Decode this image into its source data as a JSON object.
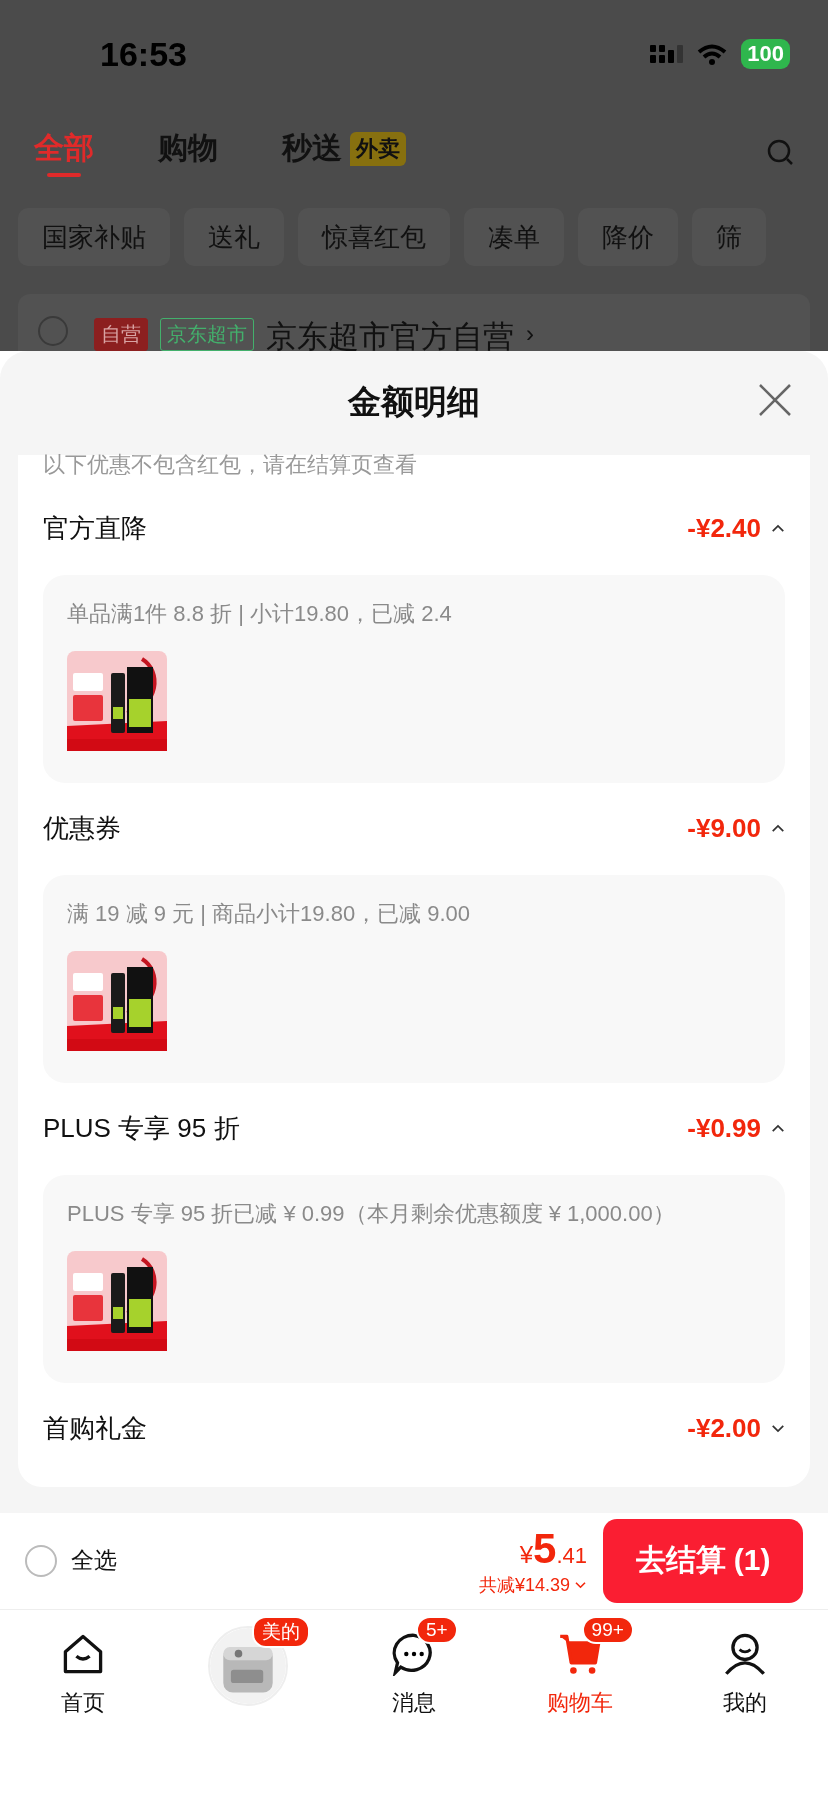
{
  "status_bar": {
    "time": "16:53",
    "battery": "100"
  },
  "tabs": [
    {
      "label": "全部",
      "selected": true
    },
    {
      "label": "购物",
      "selected": false
    },
    {
      "label": "秒送",
      "badge": "外卖",
      "selected": false
    }
  ],
  "filters": [
    "国家补贴",
    "送礼",
    "惊喜红包",
    "凑单",
    "降价",
    "筛"
  ],
  "store": {
    "checked": false,
    "tags": [
      {
        "label": "自营",
        "color": "#8c1f1f"
      },
      {
        "label": "京东超市",
        "color": "#43b06c"
      }
    ],
    "name": "京东超市官方自营",
    "arrow": "›"
  },
  "sheet": {
    "title": "金额明细",
    "notice": "以下优惠不包含红包，请在结算页查看",
    "sections": [
      {
        "title": "官方直降",
        "amount": "-¥2.40",
        "expanded": true,
        "detail": "单品满1件 8.8 折 | 小计19.80，已减 2.4"
      },
      {
        "title": "优惠券",
        "amount": "-¥9.00",
        "expanded": true,
        "detail": "满 19 减 9 元 | 商品小计19.80，已减 9.00"
      },
      {
        "title": "PLUS 专享 95 折",
        "amount": "-¥0.99",
        "expanded": true,
        "detail": "PLUS 专享 95 折已减 ¥ 0.99（本月剩余优惠额度 ¥ 1,000.00）"
      },
      {
        "title": "首购礼金",
        "amount": "-¥2.00",
        "expanded": false
      }
    ]
  },
  "checkout": {
    "select_all": {
      "label": "全选",
      "checked": false
    },
    "currency": "¥",
    "price_int": "5",
    "price_dec": ".41",
    "saved": "共减¥14.39",
    "button": "去结算 (1)"
  },
  "nav": [
    {
      "kind": "home",
      "label": "首页",
      "selected": false
    },
    {
      "kind": "picture",
      "badge": "美的",
      "selected": false
    },
    {
      "kind": "message",
      "label": "消息",
      "badge": "5+",
      "selected": false
    },
    {
      "kind": "cart",
      "label": "购物车",
      "badge": "99+",
      "selected": true
    },
    {
      "kind": "profile",
      "label": "我的",
      "selected": false
    }
  ]
}
